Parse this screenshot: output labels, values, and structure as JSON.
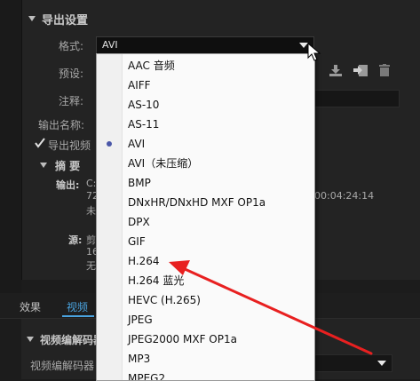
{
  "export_settings": {
    "title": "导出设置",
    "format_label": "格式:",
    "format_value": "AVI",
    "preset_label": "预设:",
    "comment_label": "注释:",
    "output_name_label": "输出名称:",
    "export_video_label": "导出视频"
  },
  "summary": {
    "title": "摘 要",
    "output_label": "输出:",
    "output_text_1": "C:",
    "output_text_2": "72",
    "output_text_3": "未",
    "output_timecode": "00:04:24:14",
    "source_label": "源:",
    "source_text_1": "剪",
    "source_text_2": "16",
    "source_text_3": "无"
  },
  "tabs": {
    "effects": "效果",
    "video": "视频"
  },
  "codec": {
    "section_title": "视频编解码器",
    "codec_label": "视频编解码器"
  },
  "dropdown": {
    "items": [
      "AAC 音频",
      "AIFF",
      "AS-10",
      "AS-11",
      "AVI",
      "AVI（未压缩）",
      "BMP",
      "DNxHR/DNxHD MXF OP1a",
      "DPX",
      "GIF",
      "H.264",
      "H.264 蓝光",
      "HEVC (H.265)",
      "JPEG",
      "JPEG2000 MXF OP1a",
      "MP3",
      "MPEG2"
    ],
    "selected": "AVI"
  },
  "colors": {
    "arrow": "#e82020",
    "selection_dot": "#4a57a8"
  }
}
